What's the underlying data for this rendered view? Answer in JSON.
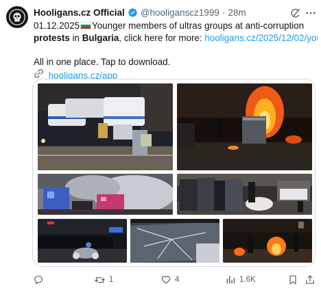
{
  "post": {
    "author_name": "Hooligans.cz Official",
    "handle": "@hooliganscz1999",
    "separator": "·",
    "time": "28m",
    "line1_date": "01.12.2025",
    "line1_rest": "Younger members of ultras groups at anti-corruption",
    "line2_bold1": "protests",
    "line2_in": " in ",
    "line2_bold2": "Bulgaria",
    "line2_rest": ", click here for more: ",
    "line2_link": "hooligans.cz/2025/12/02/you…",
    "line3": "All in one place. Tap to download.",
    "app_link": "hooligans.cz/app",
    "flag_colors": [
      "#ffffff",
      "#00966e",
      "#d62612"
    ]
  },
  "icons": {
    "verified": "verified-badge-icon",
    "grok": "grok-icon",
    "more": "more-icon",
    "link": "link-icon",
    "reply": "reply-icon",
    "repost": "repost-icon",
    "like": "like-icon",
    "views": "views-icon",
    "bookmark": "bookmark-icon",
    "share": "share-icon"
  },
  "actions": {
    "reply_count": "",
    "repost_count": "1",
    "like_count": "4",
    "view_count": "1.6K"
  },
  "colors": {
    "accent": "#1d9bf0",
    "text": "#0f1419",
    "muted": "#536471",
    "border": "#cfd9de"
  }
}
